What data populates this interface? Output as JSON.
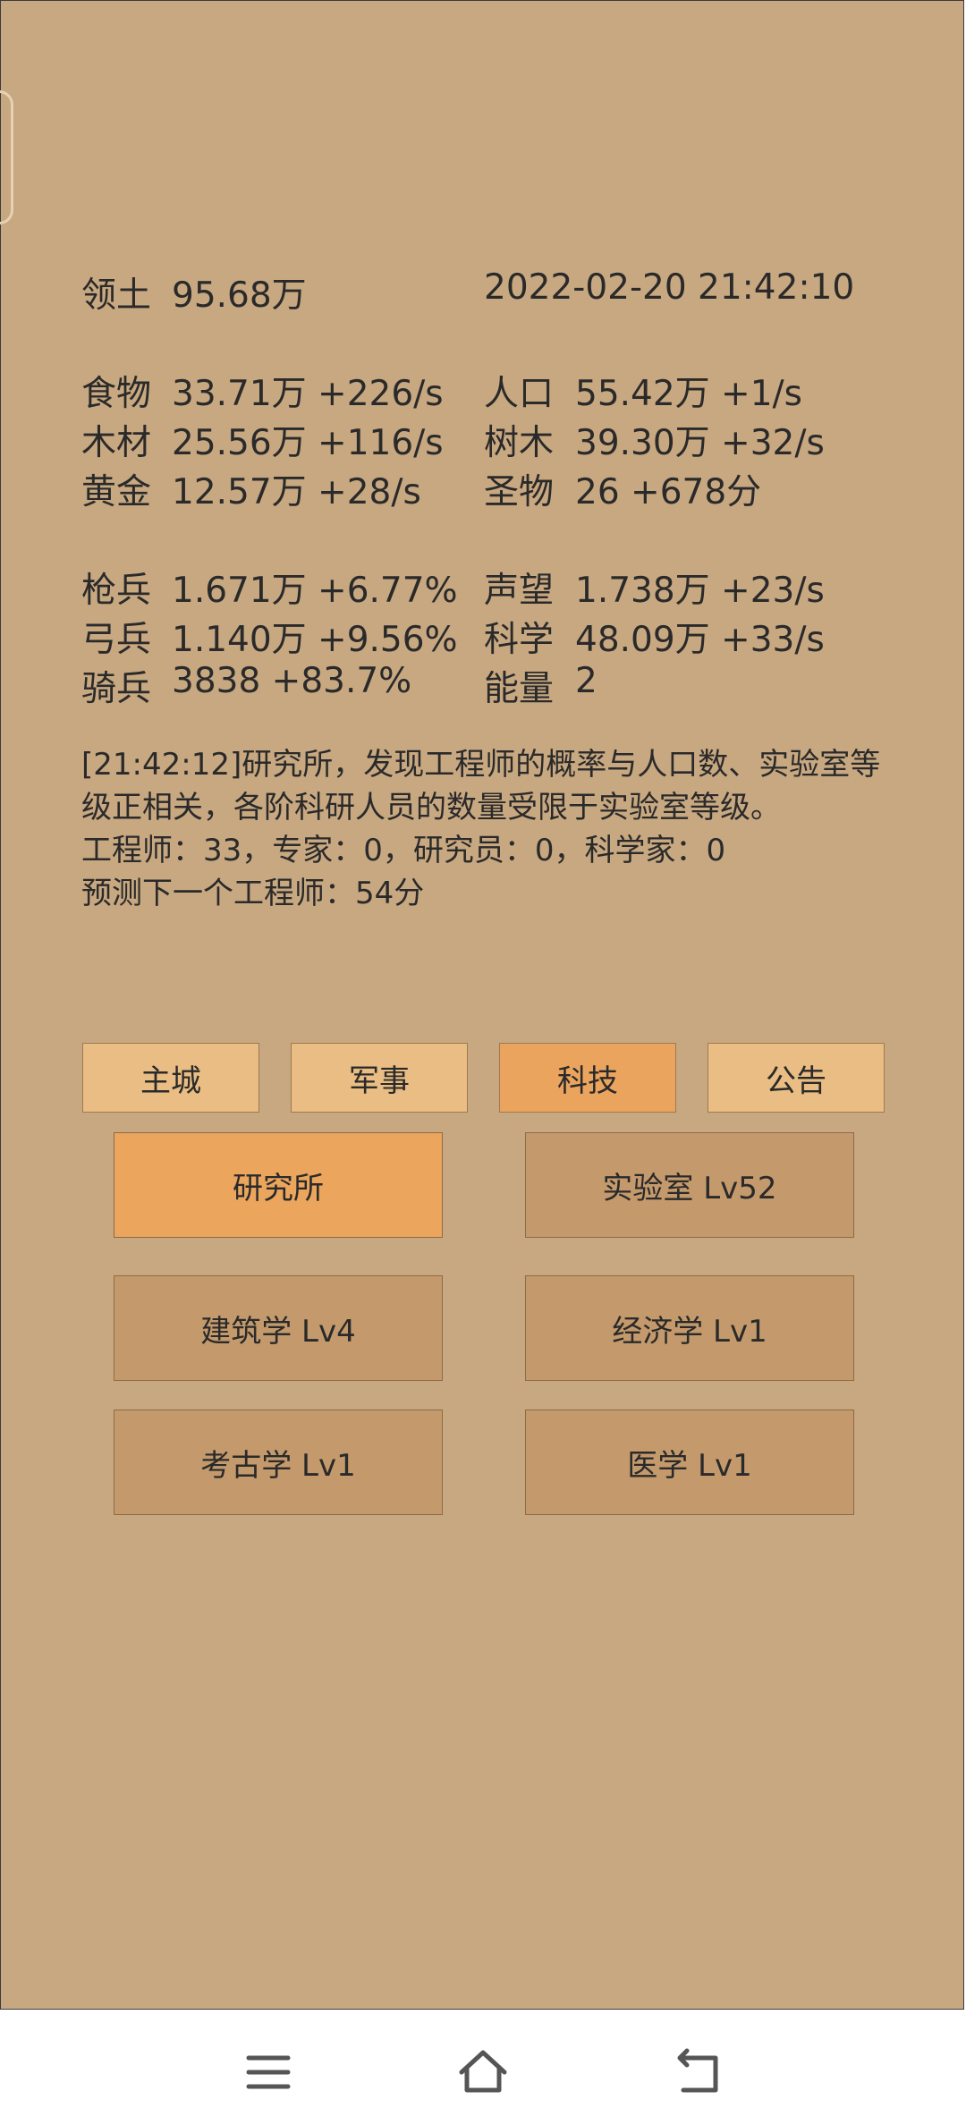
{
  "stats": {
    "territory": {
      "label": "领土",
      "value": "95.68万"
    },
    "datetime": "2022-02-20 21:42:10",
    "food": {
      "label": "食物",
      "value": "33.71万 +226/s"
    },
    "population": {
      "label": "人口",
      "value": "55.42万 +1/s"
    },
    "wood": {
      "label": "木材",
      "value": "25.56万 +116/s"
    },
    "trees": {
      "label": "树木",
      "value": "39.30万 +32/s"
    },
    "gold": {
      "label": "黄金",
      "value": "12.57万 +28/s"
    },
    "relics": {
      "label": "圣物",
      "value": "26 +678分"
    },
    "spearmen": {
      "label": "枪兵",
      "value": "1.671万 +6.77%"
    },
    "prestige": {
      "label": "声望",
      "value": "1.738万 +23/s"
    },
    "archers": {
      "label": "弓兵",
      "value": "1.140万 +9.56%"
    },
    "science": {
      "label": "科学",
      "value": "48.09万 +33/s"
    },
    "cavalry": {
      "label": "骑兵",
      "value": "3838 +83.7%"
    },
    "energy": {
      "label": "能量",
      "value": "2"
    }
  },
  "log": {
    "line1": "[21:42:12]研究所，发现工程师的概率与人口数、实验室等",
    "line2": "级正相关，各阶科研人员的数量受限于实验室等级。",
    "line3": "工程师：33，专家：0，研究员：0，科学家：0",
    "line4": "预测下一个工程师：54分"
  },
  "tabs": {
    "main_city": "主城",
    "military": "军事",
    "technology": "科技",
    "announcement": "公告"
  },
  "tech": {
    "institute": "研究所",
    "laboratory": "实验室 Lv52",
    "architecture": "建筑学 Lv4",
    "economics": "经济学 Lv1",
    "archaeology": "考古学 Lv1",
    "medicine": "医学 Lv1"
  },
  "icons": {
    "menu": "menu-icon",
    "home": "home-icon",
    "back": "back-icon"
  }
}
